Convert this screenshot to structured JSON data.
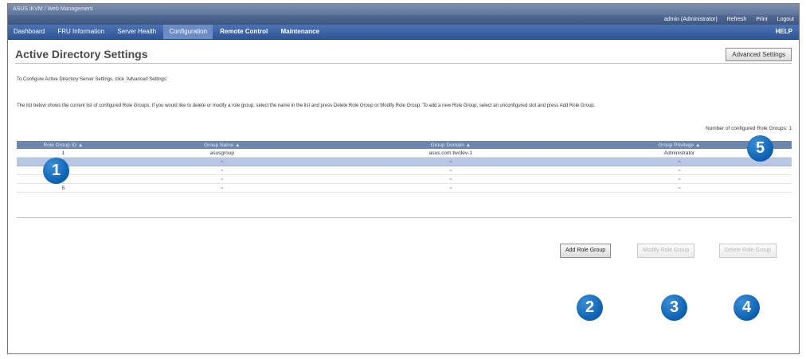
{
  "app": {
    "title_bar": "ASUS iKVM / Web Management",
    "title_bar_right": "",
    "account_links": [
      {
        "label": "admin (Administrator)"
      },
      {
        "label": "Refresh"
      },
      {
        "label": "Print"
      },
      {
        "label": "Logout"
      }
    ]
  },
  "nav": {
    "tabs": [
      {
        "label": "Dashboard"
      },
      {
        "label": "FRU Information"
      },
      {
        "label": "Server Health"
      },
      {
        "label": "Configuration"
      },
      {
        "label": "Remote Control"
      },
      {
        "label": "Maintenance"
      }
    ],
    "active_tab": "Configuration",
    "help": "HELP"
  },
  "page": {
    "title": "Active Directory Settings",
    "advanced_button": "Advanced Settings",
    "instruction": "To Configure Active Directory Server Settings, click 'Advanced Settings'",
    "description": "The list below shows the current list of configured Role Groups. If you would like to delete or modify a role group, select the name in the list and press Delete Role Group or Modify Role Group. To add a new Role Group, select an unconfigured slot and press Add Role Group.",
    "count_label": "Number of configured Role Groups: 1"
  },
  "table": {
    "columns": [
      "Role Group ID",
      "Group Name",
      "Group Domain",
      "Group Privilege"
    ],
    "rows": [
      {
        "id": "1",
        "name": "asusgroup",
        "domain": "asus.com.tw/dev-1",
        "privilege": "Administrator"
      },
      {
        "id": "2",
        "name": "~",
        "domain": "~",
        "privilege": "~"
      },
      {
        "id": "3",
        "name": "~",
        "domain": "~",
        "privilege": "~"
      },
      {
        "id": "4",
        "name": "~",
        "domain": "~",
        "privilege": "~"
      },
      {
        "id": "5",
        "name": "~",
        "domain": "~",
        "privilege": "~"
      }
    ],
    "selected_row_index": 1
  },
  "actions": {
    "add": "Add Role Group",
    "modify": "Modify Role Group",
    "delete": "Delete Role Group"
  },
  "callouts": [
    "1",
    "2",
    "3",
    "4",
    "5"
  ],
  "colors": {
    "nav": "#3b62a6",
    "table_header": "#6c86ae",
    "selected_row": "#b7c7e4",
    "callout": "#0b5fae"
  }
}
